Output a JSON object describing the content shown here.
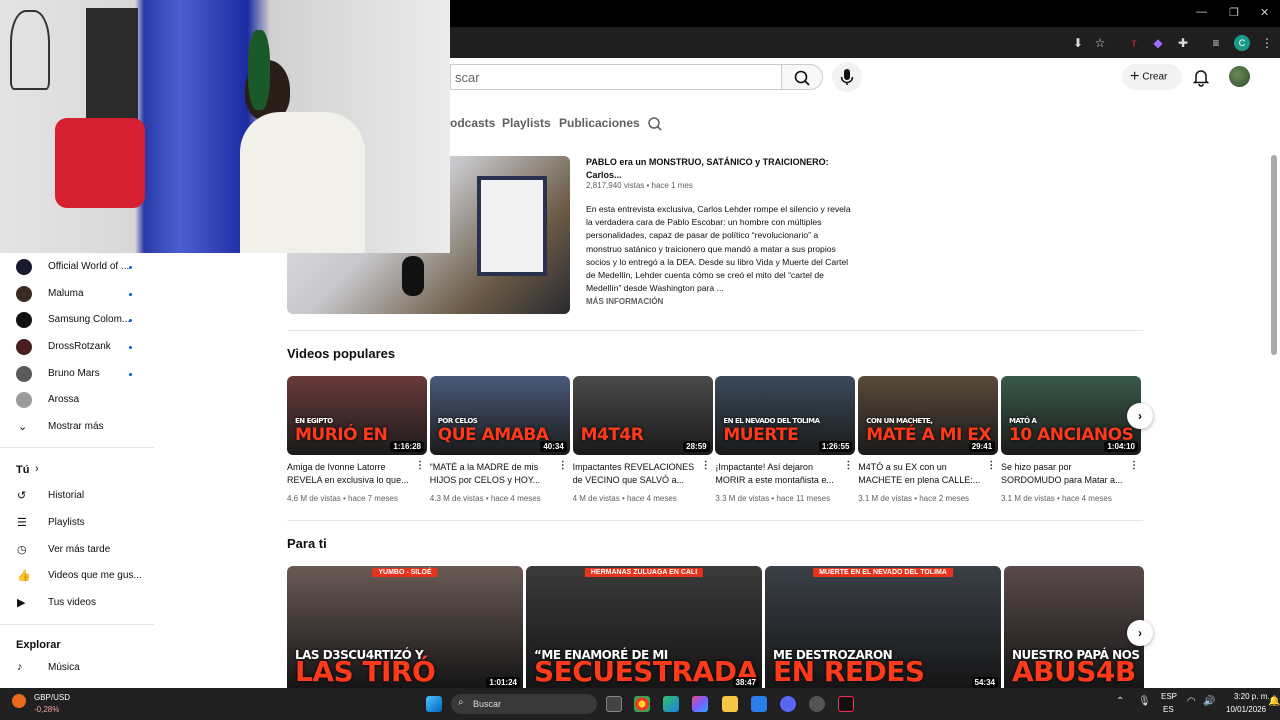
{
  "browser": {
    "ext_icons": [
      "download-icon",
      "star-icon",
      "extension-red-icon",
      "extension-purple-icon",
      "puzzle-icon",
      "playlist-icon",
      "profile-c-icon",
      "kebab-icon"
    ],
    "profile_letter": "C"
  },
  "header": {
    "search_placeholder": "Buscar",
    "search_value": "scar",
    "create_label": "Crear"
  },
  "channel_tabs": [
    {
      "label": "odcasts"
    },
    {
      "label": "Playlists"
    },
    {
      "label": "Publicaciones"
    }
  ],
  "featured": {
    "title": "PABLO era un MONSTRUO, SATÁNICO y TRAICIONERO: Carlos...",
    "meta": "2,817,940 vistas • hace 1 mes",
    "description": "En esta entrevista exclusiva, Carlos Lehder rompe el silencio y revela la verdadera cara de Pablo Escobar: un hombre con múltiples personalidades, capaz de pasar de político “revolucionario” a monstruo satánico y traicionero que mandó a matar a sus propios socios y lo entregó a la DEA. Desde su libro Vida y Muerte del Cartel de Medellín, Lehder cuenta cómo se creó el mito del “cartel de Medellín” desde Washington para ...",
    "more": "MÁS INFORMACIÓN"
  },
  "sidebar": {
    "subscriptions": [
      {
        "name": "Official World of ...",
        "color": "#1a1a2e"
      },
      {
        "name": "Maluma",
        "color": "#3a2a22"
      },
      {
        "name": "Samsung Colom...",
        "color": "#111111"
      },
      {
        "name": "DrossRotzank",
        "color": "#4a1f1f"
      },
      {
        "name": "Bruno Mars",
        "color": "#5a5a5a"
      },
      {
        "name": "Arossa",
        "color": "#9a9a9a"
      }
    ],
    "show_more": "Mostrar más",
    "you_label": "Tú",
    "you_items": [
      "Historial",
      "Playlists",
      "Ver más tarde",
      "Videos que me gus...",
      "Tus videos"
    ],
    "explore_label": "Explorar",
    "explore_items": [
      "Música"
    ]
  },
  "popular": {
    "title": "Videos populares",
    "videos": [
      {
        "thumb_text": "MURIÓ EN",
        "thumb_sub": "EN EGIPTO",
        "duration": "1:16:28",
        "title": "Amiga de Ivonne Latorre REVELA en exclusiva lo que...",
        "meta": "4.6 M de vistas • hace 7 meses",
        "bg": "#6a3a3a"
      },
      {
        "thumb_text": "QUE AMABA",
        "thumb_sub": "POR CELOS",
        "duration": "40:34",
        "title": "“MATÉ a la MADRE de mis HIJOS por CELOS y HOY...",
        "meta": "4.3 M de vistas • hace 4 meses",
        "bg": "#4a5a7a"
      },
      {
        "thumb_text": "M4T4R",
        "thumb_sub": "",
        "duration": "28:59",
        "title": "Impactantes REVELACIONES de VECINO que SALVÓ a...",
        "meta": "4 M de vistas • hace 4 meses",
        "bg": "#4a4a4a"
      },
      {
        "thumb_text": "MUERTE",
        "thumb_sub": "EN EL NEVADO DEL TOLIMA",
        "duration": "1:26:55",
        "title": "¡Impactante! Así dejaron MORIR a este montañista e...",
        "meta": "3.3 M de vistas • hace 11 meses",
        "bg": "#3a4a5a"
      },
      {
        "thumb_text": "MATÉ A MI EX",
        "thumb_sub": "CON UN MACHETE,",
        "duration": "29:41",
        "title": "M4TÓ a su EX con un MACHETE en plena CALLE:...",
        "meta": "3.1 M de vistas • hace 2 meses",
        "bg": "#5a4a3a"
      },
      {
        "thumb_text": "10 ANCIANOS",
        "thumb_sub": "MATÓ A",
        "duration": "1:04:10",
        "title": "Se hizo pasar por SORDOMUDO para Matar a...",
        "meta": "3.1 M de vistas • hace 4 meses",
        "bg": "#3a5a4a"
      }
    ]
  },
  "for_you": {
    "title": "Para ti",
    "videos": [
      {
        "top_label": "YUMBO - SILOÉ",
        "thumb_text": "LAS TIRÓ",
        "thumb_sub": "LAS D3SCU4RTIZÓ Y",
        "duration": "1:01:24",
        "bg": "#6a5a55"
      },
      {
        "top_label": "HERMANAS ZULUAGA EN CALI",
        "thumb_text": "SECUESTRADA",
        "thumb_sub": "“ME ENAMORÉ DE MI",
        "duration": "38:47",
        "bg": "#3a3a3a"
      },
      {
        "top_label": "MUERTE EN EL NEVADO DEL TOLIMA",
        "thumb_text": "EN REDES",
        "thumb_sub": "ME DESTROZARON",
        "duration": "54:34",
        "bg": "#3a4048"
      },
      {
        "top_label": "",
        "thumb_text": "ABUS4B",
        "thumb_sub": "NUESTRO PAPÁ NOS",
        "duration": "",
        "bg": "#5a4a4a"
      }
    ]
  },
  "taskbar": {
    "ticker_name": "GBP/USD",
    "ticker_change": "-0,28%",
    "search_label": "Buscar",
    "lang_top": "ESP",
    "lang_bottom": "ES",
    "time": "3:20 p. m.",
    "date": "10/01/2026"
  }
}
